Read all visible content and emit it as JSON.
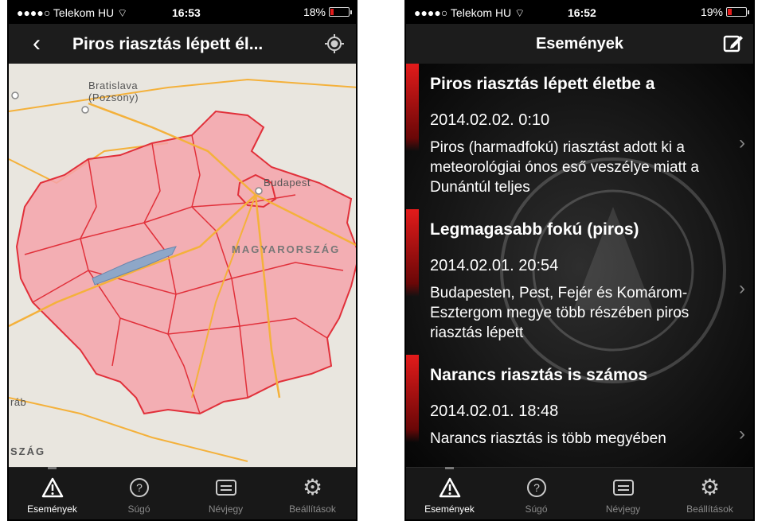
{
  "left_screen": {
    "status": {
      "signal": "●●●●○",
      "carrier": "Telekom HU",
      "time": "16:53",
      "battery": "18%",
      "battery_fraction": 0.18
    },
    "nav": {
      "title": "Piros riasztás lépett él..."
    },
    "map": {
      "labels": {
        "bratislava": "Bratislava",
        "pozsony": "(Pozsony)",
        "budapest": "Budapest",
        "country": "MAGYARORSZÁG",
        "rab": "ráb",
        "szag": "SZÁG"
      },
      "colors": {
        "background": "#e9e6df",
        "alert_fill": "#f4a3ab",
        "border": "#e1303a",
        "road": "#f4b13b",
        "lake": "#8ea7c8"
      }
    },
    "tabs": [
      {
        "label": "Események",
        "icon": "warning-triangle-icon",
        "active": true
      },
      {
        "label": "Súgó",
        "icon": "question-circle-icon",
        "active": false
      },
      {
        "label": "Névjegy",
        "icon": "card-icon",
        "active": false
      },
      {
        "label": "Beállítások",
        "icon": "gear-icon",
        "active": false
      }
    ]
  },
  "right_screen": {
    "status": {
      "signal": "●●●●○",
      "carrier": "Telekom HU",
      "time": "16:52",
      "battery": "19%",
      "battery_fraction": 0.19
    },
    "nav": {
      "title": "Események",
      "compose_icon": "compose-icon"
    },
    "events": [
      {
        "title": "Piros riasztás lépett életbe a",
        "date": "2014.02.02. 0:10",
        "body": "Piros (harmadfokú) riasztást adott ki a meteorológiai ónos eső veszélye miatt a Dunántúl teljes"
      },
      {
        "title": "Legmagasabb fokú (piros)",
        "date": "2014.02.01. 20:54",
        "body": "Budapesten, Pest, Fejér és Komárom-Esztergom megye több részében piros riasztás lépett"
      },
      {
        "title": "Narancs riasztás is számos",
        "date": "2014.02.01. 18:48",
        "body": "Narancs riasztás is több megyében"
      }
    ],
    "tabs": [
      {
        "label": "Események",
        "icon": "warning-triangle-icon",
        "active": true
      },
      {
        "label": "Súgó",
        "icon": "question-circle-icon",
        "active": false
      },
      {
        "label": "Névjegy",
        "icon": "card-icon",
        "active": false
      },
      {
        "label": "Beállítások",
        "icon": "gear-icon",
        "active": false
      }
    ],
    "accent": "#e31b1b"
  }
}
